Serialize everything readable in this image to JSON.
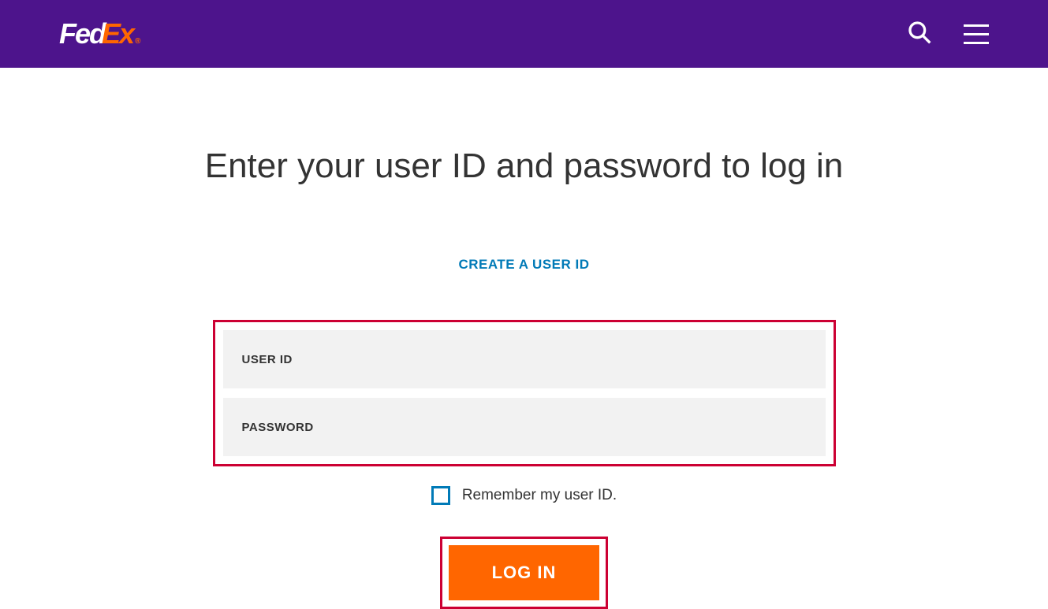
{
  "header": {
    "logo": {
      "part1": "Fed",
      "part2": "Ex",
      "reg": "®"
    }
  },
  "page": {
    "title": "Enter your user ID and password to log in",
    "create_link": "CREATE A USER ID"
  },
  "form": {
    "user_id_placeholder": "USER ID",
    "user_id_value": "",
    "password_placeholder": "PASSWORD",
    "password_value": "",
    "remember_label": "Remember my user ID.",
    "login_button": "LOG IN"
  }
}
